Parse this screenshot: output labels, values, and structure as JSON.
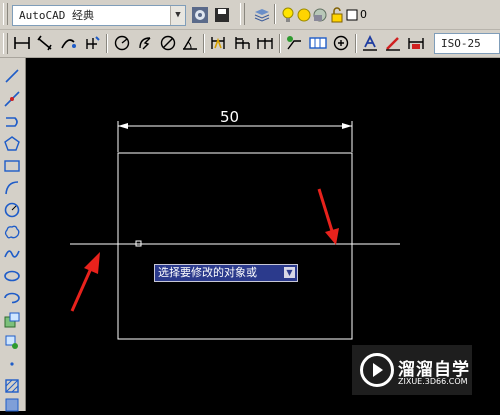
{
  "toolbar": {
    "workspace": "AutoCAD 经典",
    "layer_value": "0",
    "dim_style": "ISO-25"
  },
  "drawing": {
    "dimension_value": "50"
  },
  "prompt": {
    "text": "选择要修改的对象或"
  },
  "watermark": {
    "brand": "溜溜自学",
    "url": "ZIXUE.3D66.COM"
  },
  "colors": {
    "canvas": "#000000",
    "linework": "#ffffff",
    "annotation_arrow": "#e8221c",
    "prompt_bg": "#2b3a8c"
  }
}
